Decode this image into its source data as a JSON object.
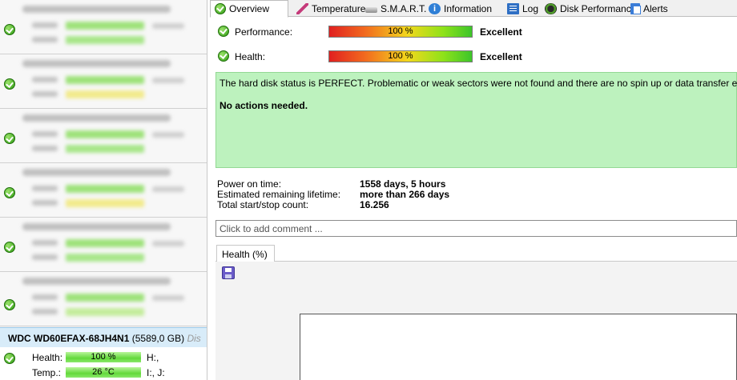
{
  "tabs": [
    {
      "label": "Overview",
      "icon": "check-circle-icon"
    },
    {
      "label": "Temperature",
      "icon": "thermometer-icon"
    },
    {
      "label": "S.M.A.R.T.",
      "icon": "drive-icon"
    },
    {
      "label": "Information",
      "icon": "info-icon"
    },
    {
      "label": "Log",
      "icon": "log-icon"
    },
    {
      "label": "Disk Performance",
      "icon": "performance-icon"
    },
    {
      "label": "Alerts",
      "icon": "alerts-icon"
    }
  ],
  "overview": {
    "performance": {
      "label": "Performance:",
      "bar_text": "100 %",
      "value": 100,
      "rating": "Excellent"
    },
    "health": {
      "label": "Health:",
      "bar_text": "100 %",
      "value": 100,
      "rating": "Excellent"
    },
    "status_message": "The hard disk status is PERFECT. Problematic or weak sectors were not found and there are no spin up or data transfer errors.",
    "action": "No actions needed.",
    "details": [
      {
        "label": "Power on time:",
        "value": "1558 days, 5 hours"
      },
      {
        "label": "Estimated remaining lifetime:",
        "value": "more than 266 days"
      },
      {
        "label": "Total start/stop count:",
        "value": "16.256"
      }
    ],
    "comment_placeholder": "Click to add comment ..."
  },
  "chart_tab": {
    "label": "Health (%)"
  },
  "sidebar": {
    "selected_disk": {
      "model": "WDC WD60EFAX-68JH4N1",
      "capacity": "(5589,0 GB)",
      "desc": "Dis",
      "health_label": "Health:",
      "health_value": "100 %",
      "health_drives": "H:,",
      "temp_label": "Temp.:",
      "temp_value": "26 °C",
      "temp_drives": "I:, J:"
    }
  },
  "colors": {
    "status_bg": "#bdf2be",
    "selected_header": "#d8ecf9",
    "ok_green": "#2d9a12"
  }
}
